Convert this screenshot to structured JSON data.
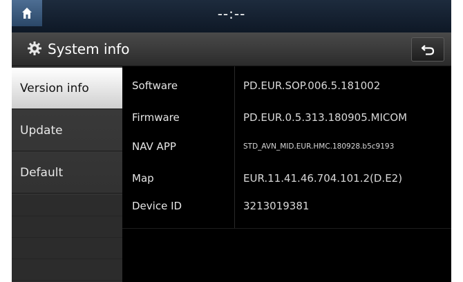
{
  "status": {
    "clock": "--:--"
  },
  "header": {
    "title": "System info"
  },
  "sidebar": {
    "items": [
      {
        "label": "Version info"
      },
      {
        "label": "Update"
      },
      {
        "label": "Default"
      }
    ]
  },
  "info": {
    "rows": [
      {
        "label": "Software",
        "value": "PD.EUR.SOP.006.5.181002"
      },
      {
        "label": "Firmware",
        "value": "PD.EUR.0.5.313.180905.MICOM"
      },
      {
        "label": "NAV APP",
        "value": "STD_AVN_MID.EUR.HMC.180928.b5c9193"
      },
      {
        "label": "Map",
        "value": "EUR.11.41.46.704.101.2(D.E2)"
      },
      {
        "label": "Device ID",
        "value": "3213019381"
      }
    ]
  },
  "icons": {
    "home": "home-icon",
    "settings": "gear-icon",
    "back": "back-arrow-icon"
  }
}
